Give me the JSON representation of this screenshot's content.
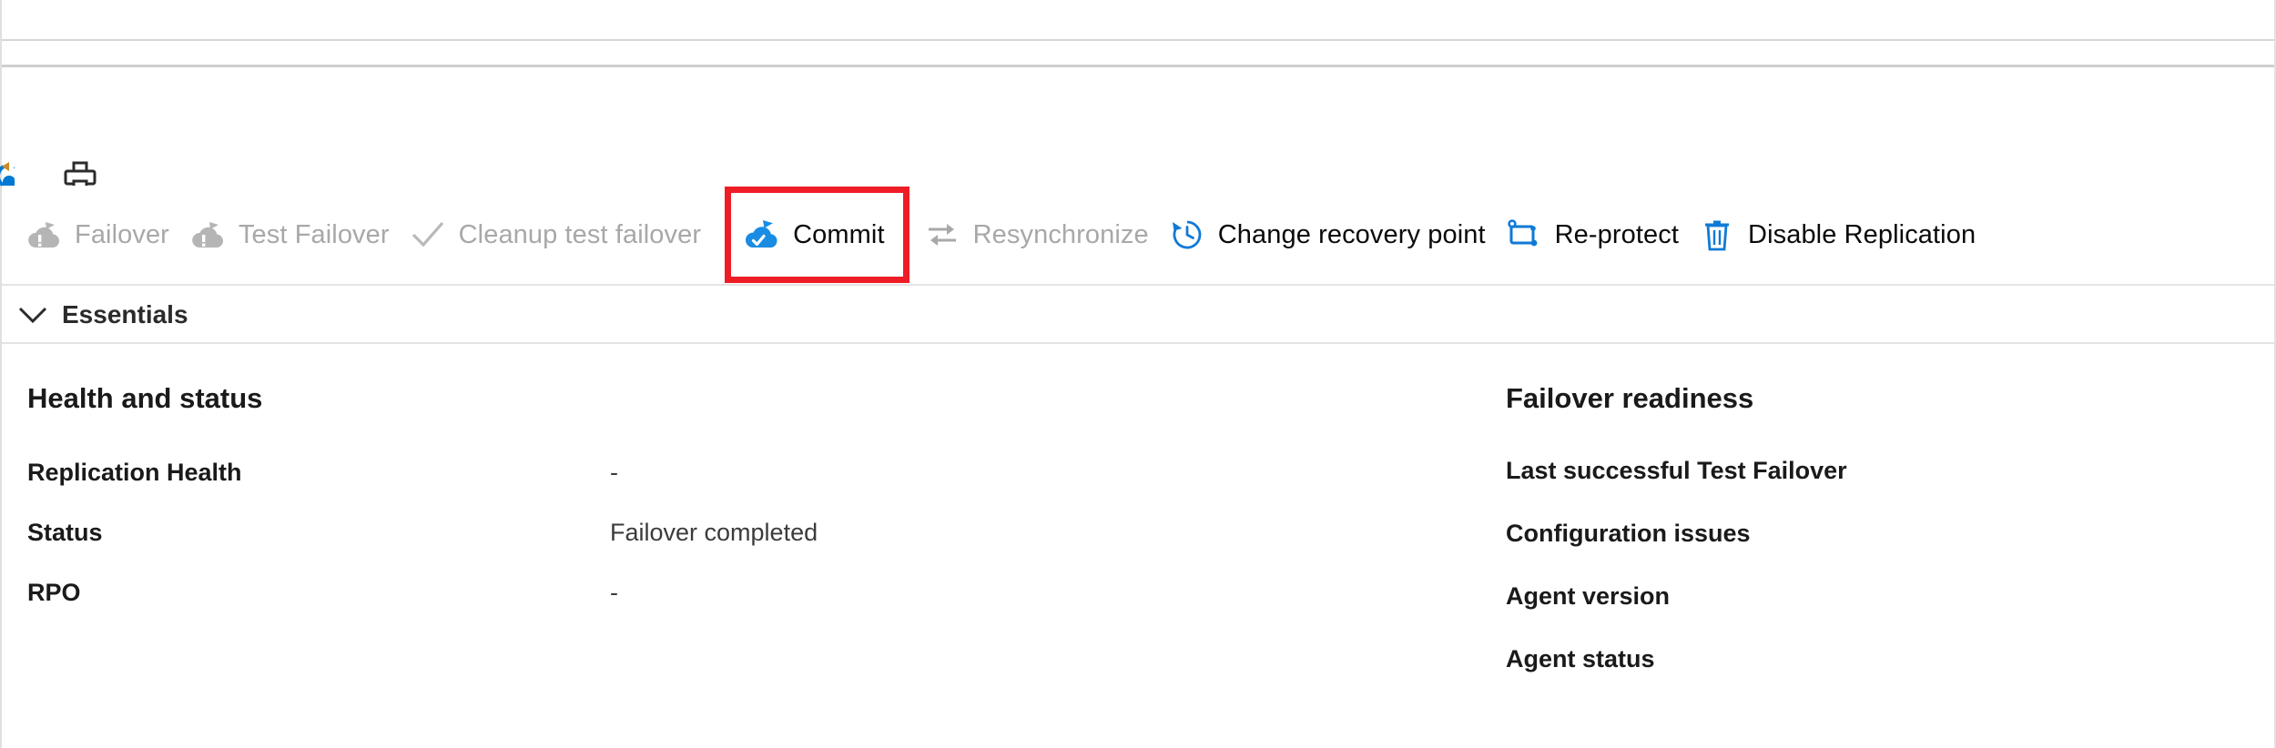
{
  "window": {
    "chrome_bars": 2
  },
  "icon_strip": {
    "clipped_icon": "replicate-icon",
    "print_button": {
      "name": "print-icon",
      "tooltip": "Print"
    }
  },
  "toolbar": {
    "items": [
      {
        "label": "Failover",
        "icon": "failover-cloud-icon",
        "enabled": false,
        "highlighted": false
      },
      {
        "label": "Test Failover",
        "icon": "test-failover-cloud-icon",
        "enabled": false,
        "highlighted": false
      },
      {
        "label": "Cleanup test failover",
        "icon": "checkmark-icon",
        "enabled": false,
        "highlighted": false
      },
      {
        "label": "Commit",
        "icon": "commit-cloud-check-icon",
        "enabled": true,
        "highlighted": true
      },
      {
        "label": "Resynchronize",
        "icon": "resynchronize-arrows-icon",
        "enabled": false,
        "highlighted": false
      },
      {
        "label": "Change recovery point",
        "icon": "history-clock-icon",
        "enabled": true,
        "highlighted": false
      },
      {
        "label": "Re-protect",
        "icon": "re-protect-icon",
        "enabled": true,
        "highlighted": false
      },
      {
        "label": "Disable Replication",
        "icon": "trash-can-icon",
        "enabled": true,
        "highlighted": false
      }
    ]
  },
  "essentials": {
    "label": "Essentials",
    "expanded": true,
    "chevron": "chevron-down-icon"
  },
  "health_and_status": {
    "title": "Health and status",
    "rows": [
      {
        "key": "Replication Health",
        "value": "-"
      },
      {
        "key": "Status",
        "value": "Failover completed"
      },
      {
        "key": "RPO",
        "value": "-"
      }
    ]
  },
  "failover_readiness": {
    "title": "Failover readiness",
    "rows": [
      {
        "key": "Last successful Test Failover",
        "value": ""
      },
      {
        "key": "Configuration issues",
        "value": ""
      },
      {
        "key": "Agent version",
        "value": ""
      },
      {
        "key": "Agent status",
        "value": ""
      }
    ]
  },
  "colors": {
    "accent_blue": "#0078d4",
    "highlight_red": "#ee1c25",
    "disabled_gray": "#a8a8a8",
    "text_dark": "#1a1a1a",
    "border_gray": "#e3e3e3"
  }
}
